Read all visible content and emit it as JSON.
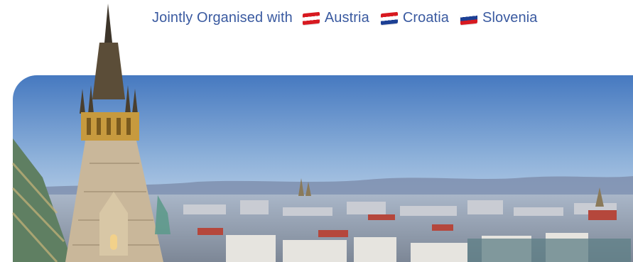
{
  "header": {
    "prefix": "Jointly Organised with",
    "countries": [
      {
        "name": "Austria",
        "flag_icon": "austria-flag-icon",
        "colors": [
          "#d71920",
          "#ffffff",
          "#d71920"
        ]
      },
      {
        "name": "Croatia",
        "flag_icon": "croatia-flag-icon",
        "colors": [
          "#d71920",
          "#ffffff",
          "#1c3f94"
        ]
      },
      {
        "name": "Slovenia",
        "flag_icon": "slovenia-flag-icon",
        "colors": [
          "#ffffff",
          "#1c3f94",
          "#d71920"
        ]
      }
    ],
    "text_color": "#3a5aa0"
  },
  "hero": {
    "subject": "Vienna skyline with St. Stephen's Cathedral spire",
    "sky_top": "#4a7fc4",
    "sky_bottom": "#dfe9f3"
  }
}
